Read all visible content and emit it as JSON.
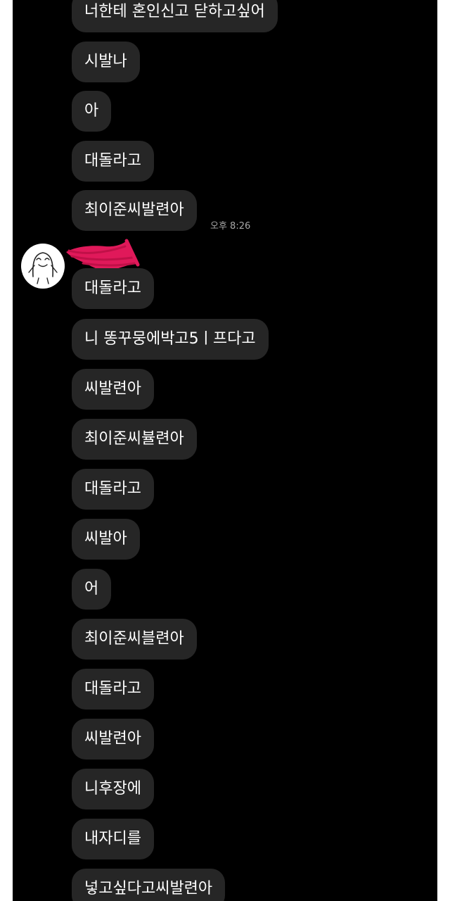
{
  "colors": {
    "screen_background": "#000000",
    "bubble_background": "#262626",
    "text": "#ffffff",
    "timestamp": "#a8a8a8",
    "redaction": "#e0195a"
  },
  "icons": {
    "avatar": "doodle-avatar-icon",
    "redaction": "pink-scribble-redaction"
  },
  "chat": {
    "timestamp": "오후 8:26",
    "messages": [
      {
        "text": "너한테 혼인신고 닫하고싶어"
      },
      {
        "text": "시발나"
      },
      {
        "text": "아"
      },
      {
        "text": "대돌라고"
      },
      {
        "text": "최이준씨발련아"
      },
      {
        "text": "대돌라고"
      },
      {
        "text": "니 똥꾸뭉에박고5ㅣ프다고"
      },
      {
        "text": "씨발련아"
      },
      {
        "text": "최이준씨뷸련아"
      },
      {
        "text": "대돌라고"
      },
      {
        "text": "씨발아"
      },
      {
        "text": "어"
      },
      {
        "text": "최이준씨블련아"
      },
      {
        "text": "대돌라고"
      },
      {
        "text": "씨발련아"
      },
      {
        "text": "니후장에"
      },
      {
        "text": "내자디를"
      },
      {
        "text": "넣고싶다고씨발련아"
      }
    ]
  }
}
